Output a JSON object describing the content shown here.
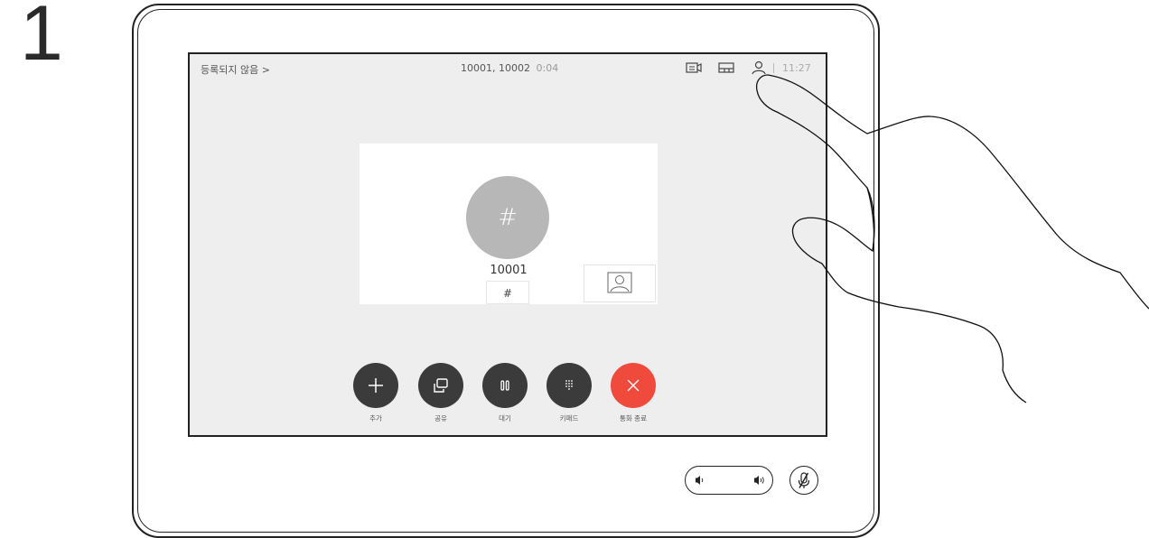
{
  "step": {
    "number": "1"
  },
  "status_bar": {
    "registration": "등록되지 않음 >",
    "participants": "10001, 10002",
    "duration": "0:04",
    "time": "11:27",
    "icons": [
      "camera-control-icon",
      "layout-icon",
      "participants-icon"
    ]
  },
  "call": {
    "avatar_glyph": "#",
    "callee_number": "10001",
    "keypad_tag": "#"
  },
  "controls": [
    {
      "name": "add",
      "label": "추가",
      "icon": "plus-icon"
    },
    {
      "name": "share",
      "label": "공유",
      "icon": "share-icon"
    },
    {
      "name": "hold",
      "label": "대기",
      "icon": "pause-icon"
    },
    {
      "name": "keypad",
      "label": "키패드",
      "icon": "keypad-icon"
    },
    {
      "name": "end-call",
      "label": "통화 종료",
      "icon": "close-icon",
      "color": "#f04a3d"
    }
  ],
  "hardware": {
    "volume_icons": [
      "volume-down-icon",
      "volume-up-icon"
    ],
    "mute_icon": "microphone-muted-icon"
  },
  "colors": {
    "screen_bg": "#eeeeee",
    "button_bg": "#3b3b3b",
    "end_call": "#f04a3d",
    "avatar_bg": "#b7b7b7"
  }
}
